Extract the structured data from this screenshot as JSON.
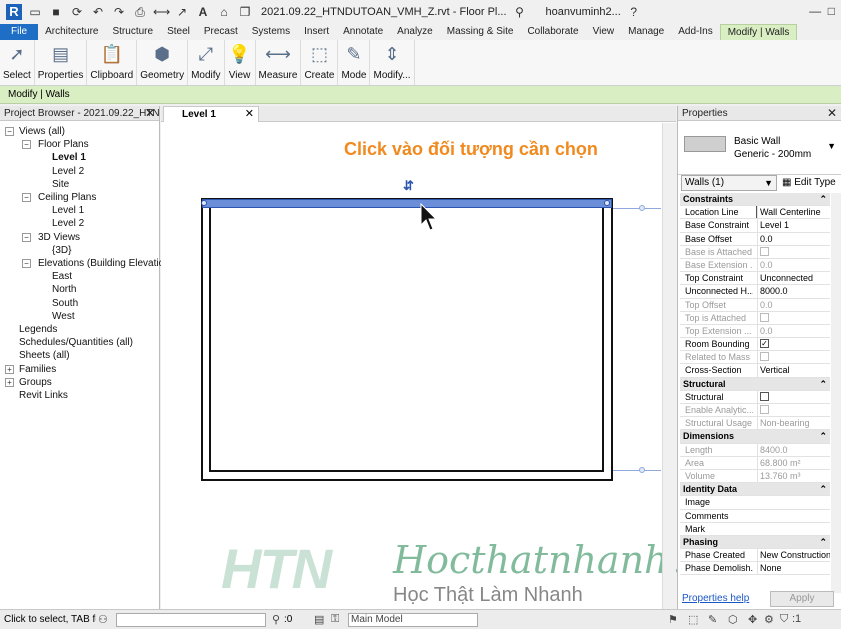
{
  "app": {
    "doc_title": "2021.09.22_HTNDUTOAN_VMH_Z.rvt - Floor Pl...",
    "user": "hoanvuminh2..."
  },
  "tabs": [
    "File",
    "Architecture",
    "Structure",
    "Steel",
    "Precast",
    "Systems",
    "Insert",
    "Annotate",
    "Analyze",
    "Massing & Site",
    "Collaborate",
    "View",
    "Manage",
    "Add-Ins",
    "Modify | Walls"
  ],
  "ribbon": [
    {
      "label": "Select",
      "icon": "select-arrow-icon"
    },
    {
      "label": "Properties",
      "icon": "properties-icon"
    },
    {
      "label": "Clipboard",
      "icon": "clipboard-icon"
    },
    {
      "label": "Geometry",
      "icon": "geometry-icon"
    },
    {
      "label": "Modify",
      "icon": "modify-icon"
    },
    {
      "label": "View",
      "icon": "view-bulb-icon"
    },
    {
      "label": "Measure",
      "icon": "measure-icon"
    },
    {
      "label": "Create",
      "icon": "create-icon"
    },
    {
      "label": "Mode",
      "icon": "mode-edit-icon"
    },
    {
      "label": "Modify...",
      "icon": "modify-profile-icon"
    }
  ],
  "context_bar": "Modify | Walls",
  "project_browser": {
    "title": "Project Browser - 2021.09.22_HTN...",
    "nodes": [
      {
        "label": "Views (all)",
        "level": 0
      },
      {
        "label": "Floor Plans",
        "level": 1
      },
      {
        "label": "Level 1",
        "level": 2,
        "bold": true
      },
      {
        "label": "Level 2",
        "level": 2
      },
      {
        "label": "Site",
        "level": 2
      },
      {
        "label": "Ceiling Plans",
        "level": 1
      },
      {
        "label": "Level 1",
        "level": 2
      },
      {
        "label": "Level 2",
        "level": 2
      },
      {
        "label": "3D Views",
        "level": 1
      },
      {
        "label": "{3D}",
        "level": 2
      },
      {
        "label": "Elevations (Building Elevation)",
        "level": 1
      },
      {
        "label": "East",
        "level": 2
      },
      {
        "label": "North",
        "level": 2
      },
      {
        "label": "South",
        "level": 2
      },
      {
        "label": "West",
        "level": 2
      },
      {
        "label": "Legends",
        "level": 0
      },
      {
        "label": "Schedules/Quantities (all)",
        "level": 0
      },
      {
        "label": "Sheets (all)",
        "level": 0
      },
      {
        "label": "Families",
        "level": 0
      },
      {
        "label": "Groups",
        "level": 0
      },
      {
        "label": "Revit Links",
        "level": 0
      }
    ]
  },
  "view": {
    "tab_label": "Level 1",
    "hint": "Click vào đối tượng cần chọn",
    "watermark_logo": "HTN",
    "watermark_site": "Hocthatnhanh.vn",
    "watermark_slogan": "Học Thật  Làm Nhanh"
  },
  "properties": {
    "title": "Properties",
    "type_family": "Basic Wall",
    "type_name": "Generic - 200mm",
    "instance_filter": "Walls (1)",
    "edit_type": "Edit Type",
    "rows": [
      {
        "group": "Constraints"
      },
      {
        "k": "Location Line",
        "v": "Wall Centerline",
        "box": true
      },
      {
        "k": "Base Constraint",
        "v": "Level 1"
      },
      {
        "k": "Base Offset",
        "v": "0.0"
      },
      {
        "k": "Base is Attached",
        "cb": "off",
        "dis": true
      },
      {
        "k": "Base Extension ...",
        "v": "0.0",
        "dis": true
      },
      {
        "k": "Top Constraint",
        "v": "Unconnected"
      },
      {
        "k": "Unconnected H...",
        "v": "8000.0"
      },
      {
        "k": "Top Offset",
        "v": "0.0",
        "dis": true
      },
      {
        "k": "Top is Attached",
        "cb": "off",
        "dis": true
      },
      {
        "k": "Top Extension ...",
        "v": "0.0",
        "dis": true
      },
      {
        "k": "Room Bounding",
        "cb": "on"
      },
      {
        "k": "Related to Mass",
        "cb": "off",
        "dis": true
      },
      {
        "k": "Cross-Section",
        "v": "Vertical"
      },
      {
        "group": "Structural"
      },
      {
        "k": "Structural",
        "cb": "off"
      },
      {
        "k": "Enable Analytic...",
        "cb": "off",
        "dis": true
      },
      {
        "k": "Structural Usage",
        "v": "Non-bearing",
        "dis": true
      },
      {
        "group": "Dimensions"
      },
      {
        "k": "Length",
        "v": "8400.0",
        "dis": true
      },
      {
        "k": "Area",
        "v": "68.800 m²",
        "dis": true
      },
      {
        "k": "Volume",
        "v": "13.760 m³",
        "dis": true
      },
      {
        "group": "Identity Data"
      },
      {
        "k": "Image",
        "v": ""
      },
      {
        "k": "Comments",
        "v": ""
      },
      {
        "k": "Mark",
        "v": ""
      },
      {
        "group": "Phasing"
      },
      {
        "k": "Phase Created",
        "v": "New Construction"
      },
      {
        "k": "Phase Demolish...",
        "v": "None"
      }
    ],
    "help": "Properties help",
    "apply": "Apply"
  },
  "status": {
    "text": "Click to select, TAB for alternates",
    "zero": ":0",
    "model": "Main Model",
    "filter_count": ":1"
  },
  "colors": {
    "file_tab": "#1f6ec5",
    "context_green": "#d9eec2",
    "selection_blue": "#6b8ed8",
    "hint_orange": "#f08a1f"
  }
}
